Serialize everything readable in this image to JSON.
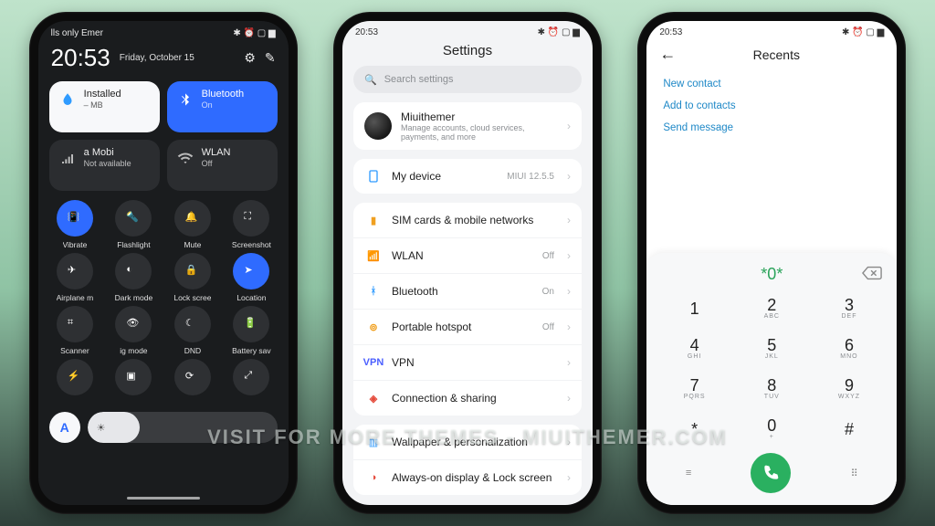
{
  "watermark": "visit for more themes - miuithemer.com",
  "status": {
    "left": "lls only    Emer",
    "time": "20:53",
    "icons": "✱ ⏰ ▢ ▆"
  },
  "cc": {
    "clock": "20:53",
    "date": "Friday, October 15",
    "t1": {
      "label": "Installed",
      "sub": "– MB"
    },
    "t2": {
      "label": "Bluetooth",
      "sub": "On"
    },
    "t3": {
      "label": "a    Mobi",
      "sub": "Not available"
    },
    "t4": {
      "label": "WLAN",
      "sub": "Off"
    },
    "toggles": [
      {
        "label": "Vibrate",
        "on": true,
        "icon": "vibrate"
      },
      {
        "label": "Flashlight",
        "on": false,
        "icon": "flashlight"
      },
      {
        "label": "Mute",
        "on": false,
        "icon": "bell"
      },
      {
        "label": "Screenshot",
        "on": false,
        "icon": "screenshot"
      },
      {
        "label": "Airplane m",
        "on": false,
        "icon": "plane"
      },
      {
        "label": "Dark mode",
        "on": false,
        "icon": "contrast"
      },
      {
        "label": "Lock scree",
        "on": false,
        "icon": "lock"
      },
      {
        "label": "Location",
        "on": true,
        "icon": "location"
      },
      {
        "label": "Scanner",
        "on": false,
        "icon": "scan"
      },
      {
        "label": "ig mode",
        "on": false,
        "icon": "eye"
      },
      {
        "label": "DND",
        "on": false,
        "icon": "moon"
      },
      {
        "label": "Battery sav",
        "on": false,
        "icon": "battery"
      },
      {
        "label": "",
        "on": false,
        "icon": "bolt"
      },
      {
        "label": "",
        "on": false,
        "icon": "cast"
      },
      {
        "label": "",
        "on": false,
        "icon": "sync"
      },
      {
        "label": "",
        "on": false,
        "icon": "expand"
      }
    ],
    "auto": "A"
  },
  "settings": {
    "title": "Settings",
    "search": "Search settings",
    "account": {
      "name": "Miuithemer",
      "sub": "Manage accounts, cloud services, payments, and more"
    },
    "device": {
      "label": "My device",
      "value": "MIUI 12.5.5"
    },
    "items": [
      {
        "icon": "sim",
        "color": "#f0a020",
        "label": "SIM cards & mobile networks",
        "value": ""
      },
      {
        "icon": "wifi",
        "color": "#2f9bff",
        "label": "WLAN",
        "value": "Off"
      },
      {
        "icon": "bt",
        "color": "#2f9bff",
        "label": "Bluetooth",
        "value": "On"
      },
      {
        "icon": "hotspot",
        "color": "#f0a020",
        "label": "Portable hotspot",
        "value": "Off"
      },
      {
        "icon": "vpn",
        "color": "#4b5fff",
        "label": "VPN",
        "value": ""
      },
      {
        "icon": "share",
        "color": "#e54b3c",
        "label": "Connection & sharing",
        "value": ""
      }
    ],
    "extra": [
      {
        "icon": "wall",
        "color": "#2f9bff",
        "label": "Wallpaper & personalization"
      },
      {
        "icon": "aod",
        "color": "#e54b3c",
        "label": "Always-on display & Lock screen"
      }
    ]
  },
  "dialer": {
    "title": "Recents",
    "actions": [
      "New contact",
      "Add to contacts",
      "Send message"
    ],
    "entered": "*0*",
    "keys": [
      {
        "n": "1",
        "s": ""
      },
      {
        "n": "2",
        "s": "ABC"
      },
      {
        "n": "3",
        "s": "DEF"
      },
      {
        "n": "4",
        "s": "GHI"
      },
      {
        "n": "5",
        "s": "JKL"
      },
      {
        "n": "6",
        "s": "MNO"
      },
      {
        "n": "7",
        "s": "PQRS"
      },
      {
        "n": "8",
        "s": "TUV"
      },
      {
        "n": "9",
        "s": "WXYZ"
      },
      {
        "n": "*",
        "s": ""
      },
      {
        "n": "0",
        "s": "+"
      },
      {
        "n": "#",
        "s": ""
      }
    ]
  }
}
